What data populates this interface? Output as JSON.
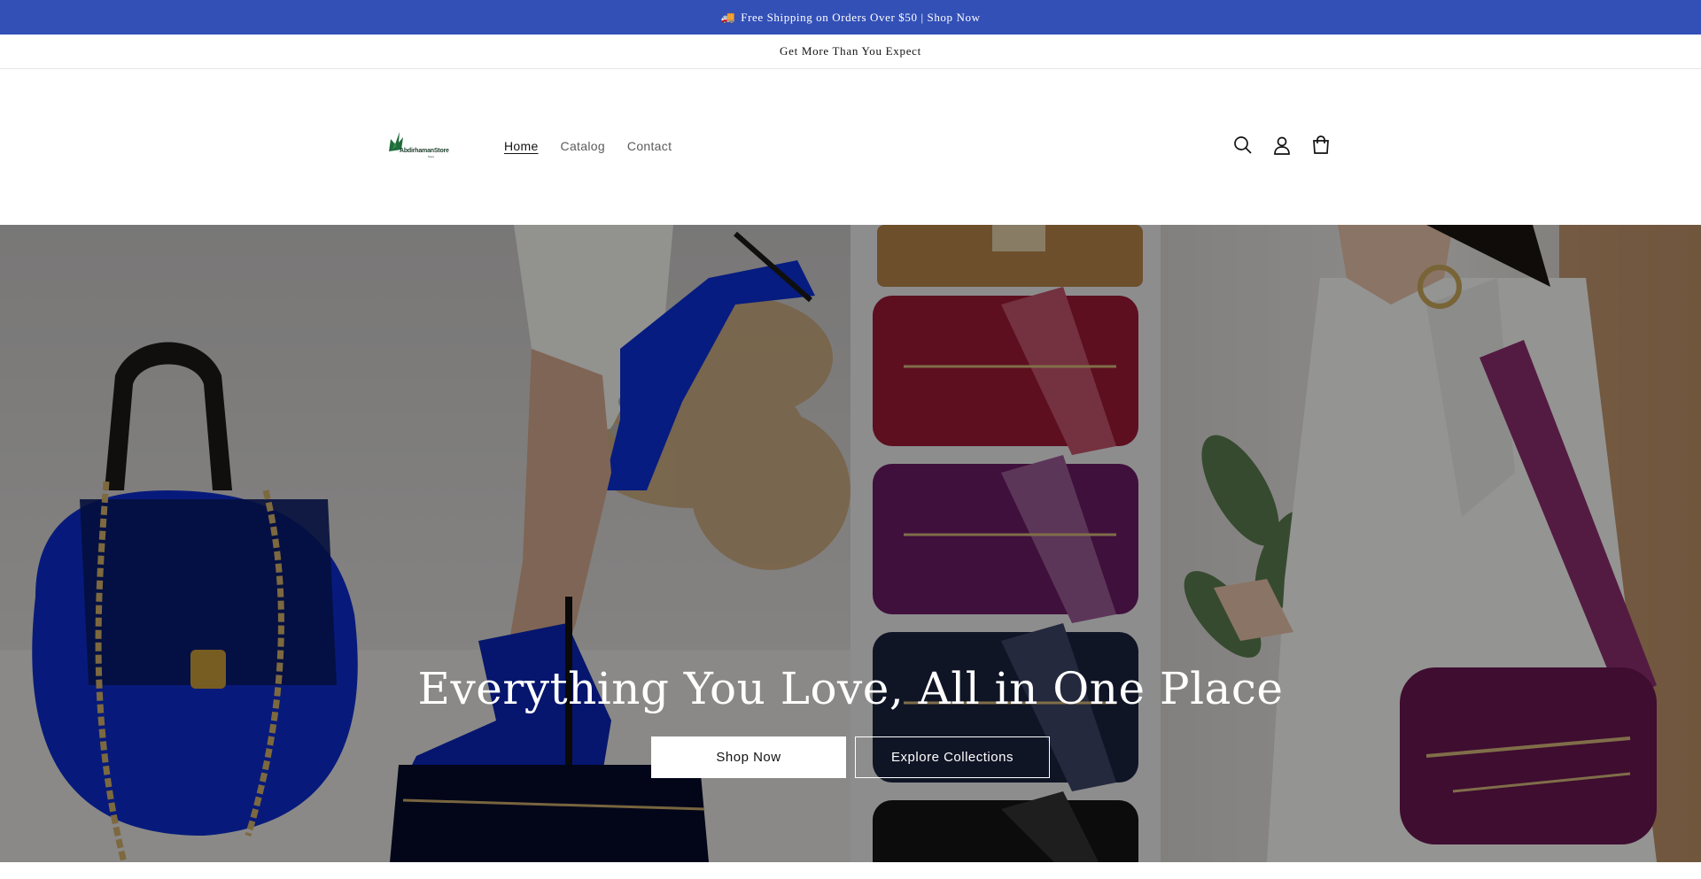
{
  "announcement": {
    "icon": "delivery-truck-icon",
    "text": "Free Shipping on Orders Over $50 | Shop Now",
    "background": "#3350b7"
  },
  "secondary_announcement": {
    "text": "Get More Than You Expect"
  },
  "header": {
    "logo_text": "AbdirhamanStore",
    "logo_subtext": "Store",
    "nav": [
      {
        "label": "Home",
        "active": true
      },
      {
        "label": "Catalog",
        "active": false
      },
      {
        "label": "Contact",
        "active": false
      }
    ],
    "icons": [
      "search-icon",
      "account-icon",
      "cart-icon"
    ]
  },
  "hero": {
    "title": "Everything You Love, All in One Place",
    "primary_button": "Shop Now",
    "secondary_button": "Explore Collections",
    "images": [
      "blue-handbag-heels-wallet",
      "crossbody-bags-stack",
      "woman-with-purple-bag"
    ]
  }
}
